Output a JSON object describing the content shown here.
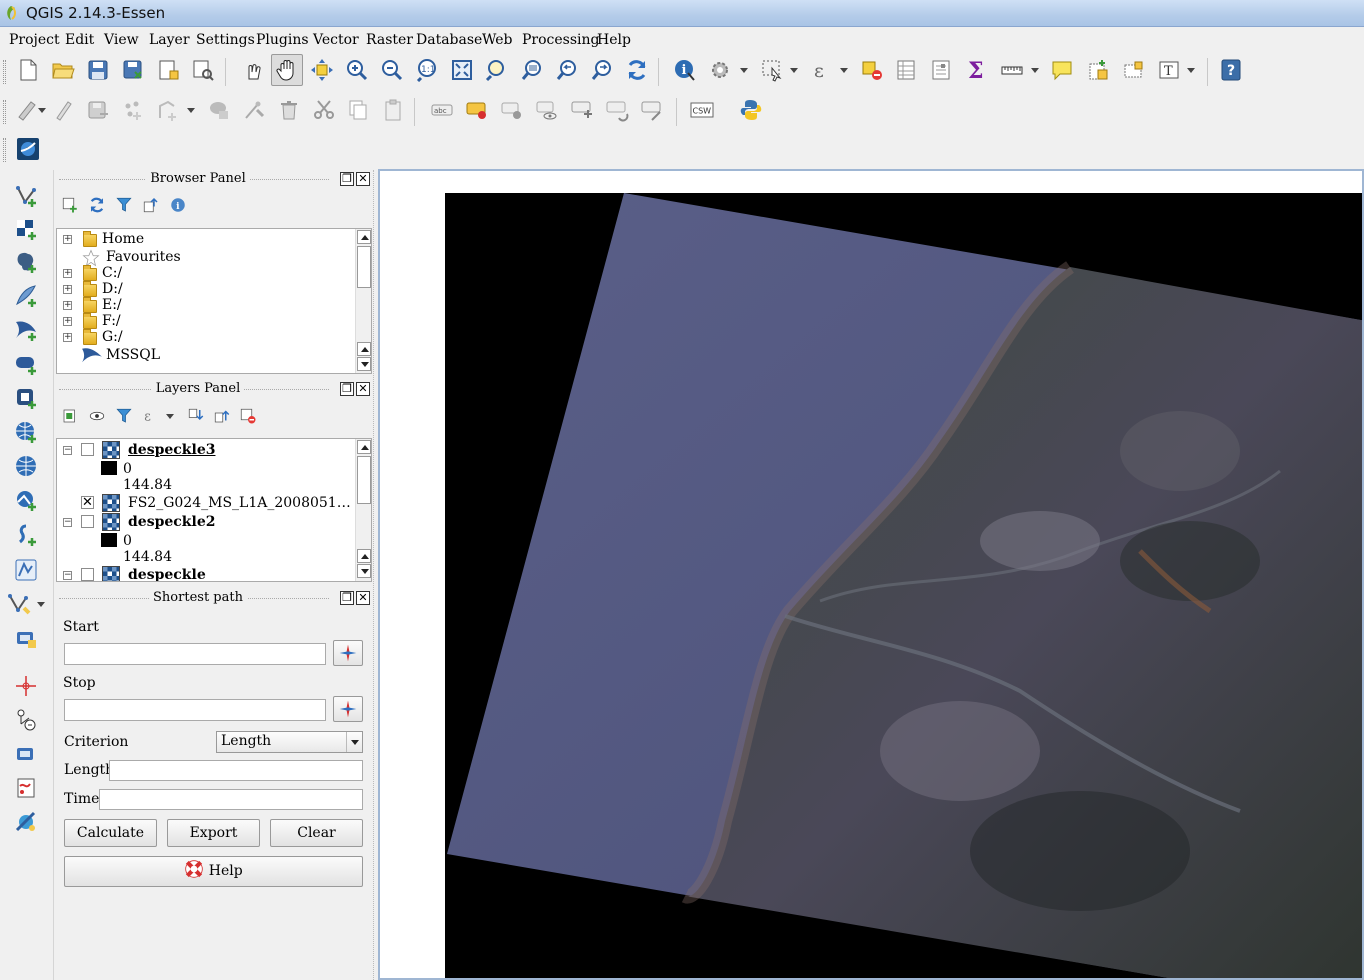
{
  "window": {
    "title": "QGIS 2.14.3-Essen"
  },
  "menu": [
    "Project",
    "Edit",
    "View",
    "Layer",
    "Settings",
    "Plugins",
    "Vector",
    "Raster",
    "Database",
    "Web",
    "Processing",
    "Help"
  ],
  "toolbar": {
    "csw_label": "CSW",
    "abc_label": "abc"
  },
  "browser_panel": {
    "title": "Browser Panel",
    "items": [
      "Home",
      "Favourites",
      "C:/",
      "D:/",
      "E:/",
      "F:/",
      "G:/",
      "MSSQL"
    ]
  },
  "layers_panel": {
    "title": "Layers Panel",
    "layers": [
      {
        "name": "despeckle3",
        "checked": false,
        "min": "0",
        "max": "144.84"
      },
      {
        "name": "FS2_G024_MS_L1A_2008051…",
        "checked": true
      },
      {
        "name": "despeckle2",
        "checked": false,
        "min": "0",
        "max": "144.84"
      },
      {
        "name": "despeckle",
        "checked": false
      }
    ]
  },
  "shortest_path": {
    "title": "Shortest path",
    "start_label": "Start",
    "stop_label": "Stop",
    "criterion_label": "Criterion",
    "criterion_value": "Length",
    "length_label": "Length",
    "time_label": "Time",
    "calculate_label": "Calculate",
    "export_label": "Export",
    "clear_label": "Clear",
    "help_label": "Help"
  },
  "icons": {
    "top_row1": [
      "new-project-icon",
      "open-project-icon",
      "save-project-icon",
      "save-as-icon",
      "new-print-composer-icon",
      "composer-manager-icon",
      "touch-zoom-icon",
      "pan-icon",
      "pan-to-selection-icon",
      "zoom-in-icon",
      "zoom-out-icon",
      "zoom-native-icon",
      "zoom-full-icon",
      "zoom-to-selection-icon",
      "zoom-to-layer-icon",
      "zoom-last-icon",
      "zoom-next-icon",
      "refresh-icon",
      "identify-icon",
      "action-icon",
      "select-feature-icon",
      "select-by-expression-icon",
      "deselect-icon",
      "attribute-table-icon",
      "field-calculator-icon",
      "statistics-icon",
      "measure-icon",
      "map-tips-icon",
      "new-bookmark-icon",
      "show-bookmarks-icon",
      "text-annotation-icon",
      "help-icon"
    ],
    "top_row2": [
      "current-edits-icon",
      "toggle-editing-icon",
      "save-edits-icon",
      "add-feature-icon",
      "node-tool-icon",
      "delete-selected-icon",
      "cut-features-icon",
      "copy-features-icon",
      "paste-features-icon",
      "label-tool-icon",
      "python-console-icon"
    ]
  }
}
